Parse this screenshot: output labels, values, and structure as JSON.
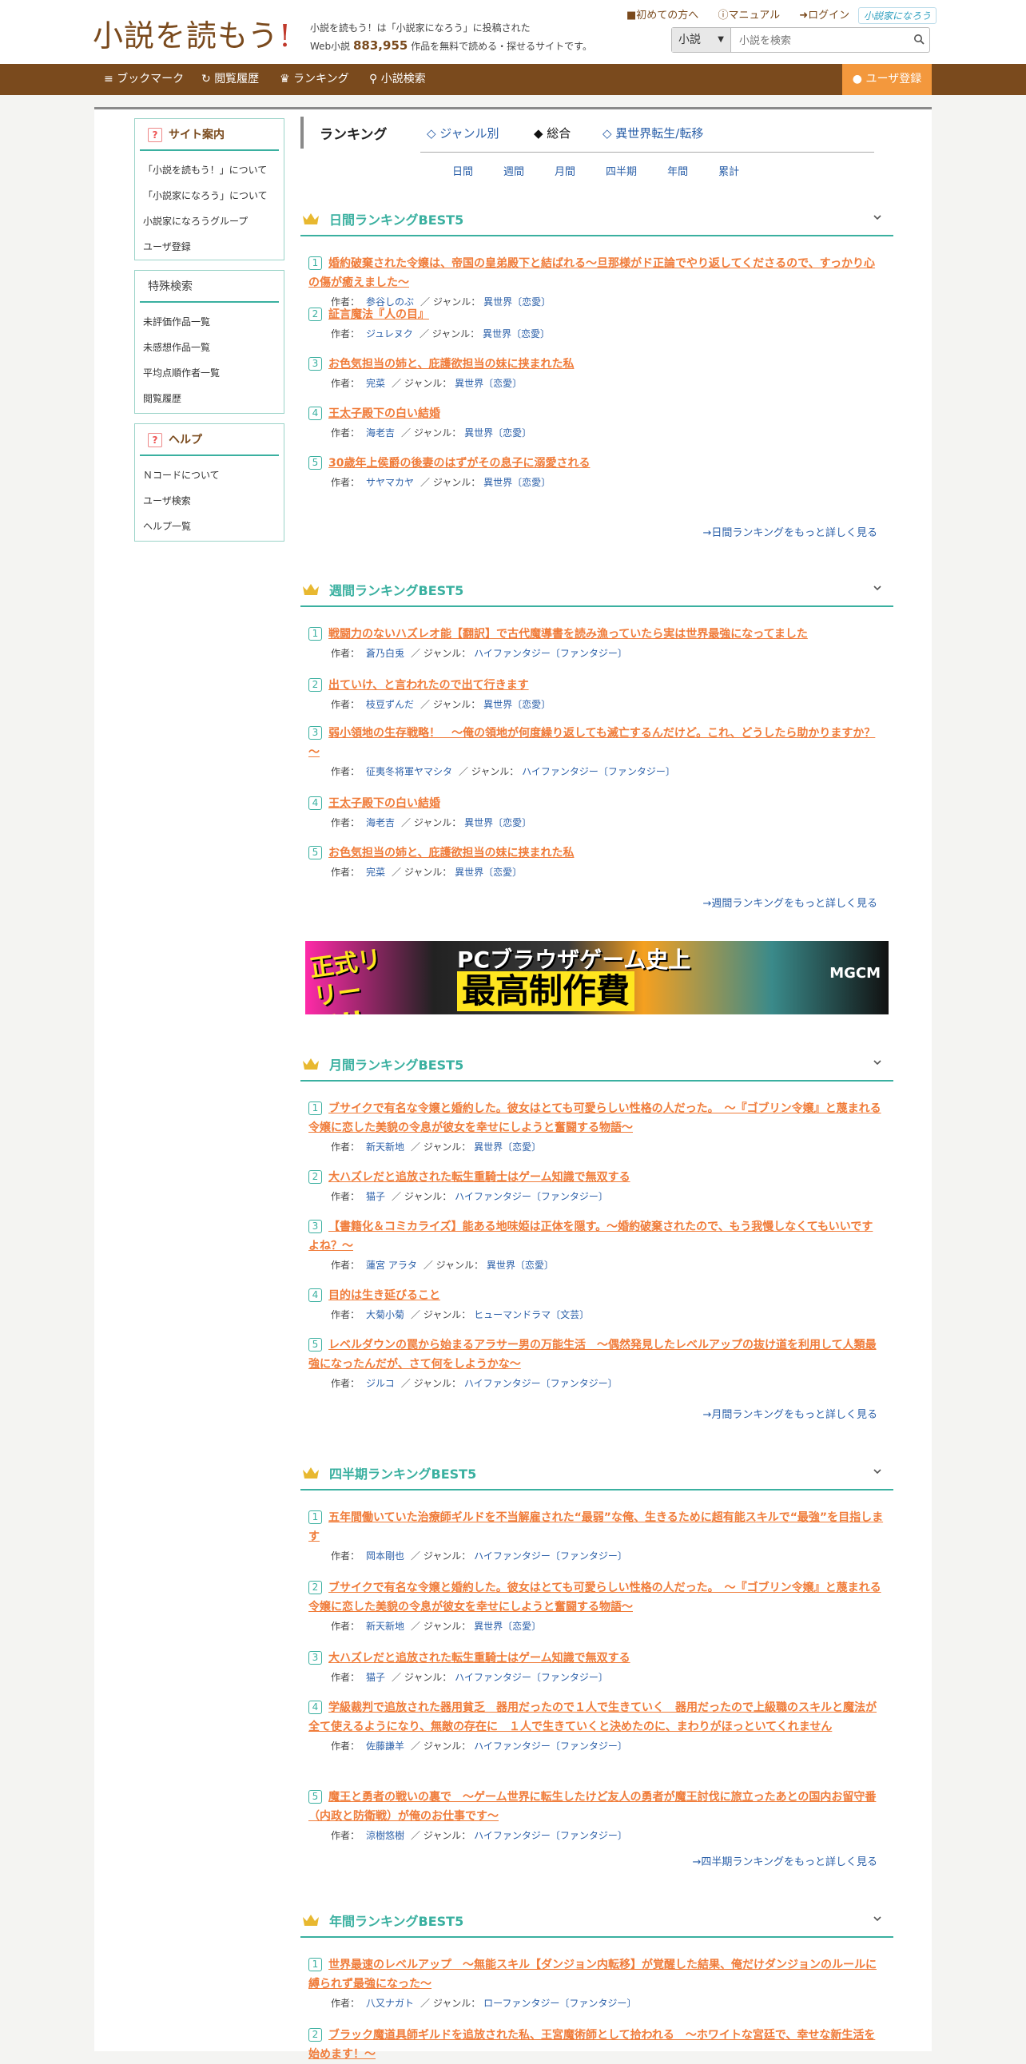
{
  "header": {
    "logo_text": "小説を読もう",
    "logo_excl": "!",
    "tagline_1": "小説を読もう！は「小説家になろう」に投稿された",
    "tagline_2a": "Web小説",
    "count": "883,955",
    "tagline_2b": "作品を無料で読める・探せるサイトです。",
    "links": [
      "初めての方へ",
      "マニュアル",
      "ログイン"
    ],
    "narou_logo": "小説家になろう",
    "search_select": "小説",
    "search_placeholder": "小説を検索"
  },
  "nav": {
    "bookmark": "ブックマーク",
    "history": "閲覧履歴",
    "ranking": "ランキング",
    "search": "小説検索",
    "user_register": "ユーザ登録"
  },
  "sidebar": {
    "site_title": "サイト案内",
    "site_items": [
      "「小説を読もう！」について",
      "「小説家になろう」について",
      "小説家になろうグループ",
      "ユーザ登録"
    ],
    "special_title": "特殊検索",
    "special_items": [
      "未評価作品一覧",
      "未感想作品一覧",
      "平均点順作者一覧",
      "閲覧履歴"
    ],
    "help_title": "ヘルプ",
    "help_items": [
      "Ｎコードについて",
      "ユーザ検索",
      "ヘルプ一覧"
    ]
  },
  "ranking": {
    "title": "ランキング",
    "tab_genre": "◇ ジャンル別",
    "tab_total": "◆ 総合",
    "tab_isekai": "◇ 異世界転生/転移",
    "periods": [
      "日間",
      "週間",
      "月間",
      "四半期",
      "年間",
      "累計"
    ]
  },
  "labels": {
    "author": "作者：",
    "genre": "／ ジャンル："
  },
  "sections": [
    {
      "title": "日間ランキングBEST5",
      "more": "→日間ランキングをもっと詳しく見る",
      "entries": [
        {
          "title": "婚約破棄された令嬢は、帝国の皇弟殿下と結ばれる～旦那様がド正論でやり返してくださるので、すっかり心の傷が癒えました～",
          "author": "参谷しのぶ",
          "genre": "異世界〔恋愛〕"
        },
        {
          "title": "証言魔法『人の目』",
          "author": "ジュレヌク",
          "genre": "異世界〔恋愛〕"
        },
        {
          "title": "お色気担当の姉と、庇護欲担当の妹に挟まれた私",
          "author": "完菜",
          "genre": "異世界〔恋愛〕"
        },
        {
          "title": "王太子殿下の白い結婚",
          "author": "海老吉",
          "genre": "異世界〔恋愛〕"
        },
        {
          "title": "30歳年上侯爵の後妻のはずがその息子に溺愛される",
          "author": "サヤマカヤ",
          "genre": "異世界〔恋愛〕"
        }
      ]
    },
    {
      "title": "週間ランキングBEST5",
      "more": "→週間ランキングをもっと詳しく見る",
      "entries": [
        {
          "title": "戦闘力のないハズレオ能【翻訳】で古代魔導書を読み漁っていたら実は世界最強になってました",
          "author": "蒼乃白兎",
          "genre": "ハイファンタジー〔ファンタジー〕"
        },
        {
          "title": "出ていけ、と言われたので出て行きます",
          "author": "枝豆ずんだ",
          "genre": "異世界〔恋愛〕"
        },
        {
          "title": "弱小領地の生存戦略！　～俺の領地が何度繰り返しても滅亡するんだけど。これ、どうしたら助かりますか？～",
          "author": "征夷冬将軍ヤマシタ",
          "genre": "ハイファンタジー〔ファンタジー〕"
        },
        {
          "title": "王太子殿下の白い結婚",
          "author": "海老吉",
          "genre": "異世界〔恋愛〕"
        },
        {
          "title": "お色気担当の姉と、庇護欲担当の妹に挟まれた私",
          "author": "完菜",
          "genre": "異世界〔恋愛〕"
        }
      ]
    },
    {
      "title": "月間ランキングBEST5",
      "more": "→月間ランキングをもっと詳しく見る",
      "entries": [
        {
          "title": "ブサイクで有名な令嬢と婚約した。彼女はとても可愛らしい性格の人だった。　～『ゴブリン令嬢』と蔑まれる令嬢に恋した美貌の令息が彼女を幸せにしようと奮闘する物語～",
          "author": "新天新地",
          "genre": "異世界〔恋愛〕"
        },
        {
          "title": "大ハズレだと追放された転生重騎士はゲーム知識で無双する",
          "author": "猫子",
          "genre": "ハイファンタジー〔ファンタジー〕"
        },
        {
          "title": "【書籍化＆コミカライズ】能ある地味姫は正体を隠す。～婚約破棄されたので、もう我慢しなくてもいいですよね？～",
          "author": "蓮宮 アラタ",
          "genre": "異世界〔恋愛〕"
        },
        {
          "title": "目的は生き延びること",
          "author": "大菊小菊",
          "genre": "ヒューマンドラマ〔文芸〕"
        },
        {
          "title": "レベルダウンの罠から始まるアラサー男の万能生活　～偶然発見したレベルアップの抜け道を利用して人類最強になったんだが、さて何をしようかな～",
          "author": "ジルコ",
          "genre": "ハイファンタジー〔ファンタジー〕"
        }
      ]
    },
    {
      "title": "四半期ランキングBEST5",
      "more": "→四半期ランキングをもっと詳しく見る",
      "entries": [
        {
          "title": "五年間働いていた治療師ギルドを不当解雇された“最弱”な俺、生きるために超有能スキルで“最強”を目指します",
          "author": "岡本剛也",
          "genre": "ハイファンタジー〔ファンタジー〕"
        },
        {
          "title": "ブサイクで有名な令嬢と婚約した。彼女はとても可愛らしい性格の人だった。　～『ゴブリン令嬢』と蔑まれる令嬢に恋した美貌の令息が彼女を幸せにしようと奮闘する物語～",
          "author": "新天新地",
          "genre": "異世界〔恋愛〕"
        },
        {
          "title": "大ハズレだと追放された転生重騎士はゲーム知識で無双する",
          "author": "猫子",
          "genre": "ハイファンタジー〔ファンタジー〕"
        },
        {
          "title": "学級裁判で追放された器用貧乏　器用だったので１人で生きていく　器用だったので上級職のスキルと魔法が全て使えるようになり、無敵の存在に　１人で生きていくと決めたのに、まわりがほっといてくれません",
          "author": "佐藤謙羊",
          "genre": "ハイファンタジー〔ファンタジー〕"
        },
        {
          "title": "魔王と勇者の戦いの裏で　～ゲーム世界に転生したけど友人の勇者が魔王討伐に旅立ったあとの国内お留守番（内政と防衛戦）が俺のお仕事です～",
          "author": "涼樹悠樹",
          "genre": "ハイファンタジー〔ファンタジー〕"
        }
      ]
    },
    {
      "title": "年間ランキングBEST5",
      "more": "",
      "entries": [
        {
          "title": "世界最速のレベルアップ　～無能スキル【ダンジョン内転移】が覚醒した結果、俺だけダンジョンのルールに縛られず最強になった～",
          "author": "八又ナガト",
          "genre": "ローファンタジー〔ファンタジー〕"
        },
        {
          "title": "ブラック魔道具師ギルドを追放された私、王宮魔術師として拾われる　～ホワイトな宮廷で、幸せな新生活を始めます！～",
          "author": "",
          "genre": ""
        }
      ]
    }
  ],
  "banner": {
    "left": "正式リリース!!",
    "mid": "PCブラウザゲーム史上",
    "big": "最高制作費",
    "right": "MGCM"
  }
}
